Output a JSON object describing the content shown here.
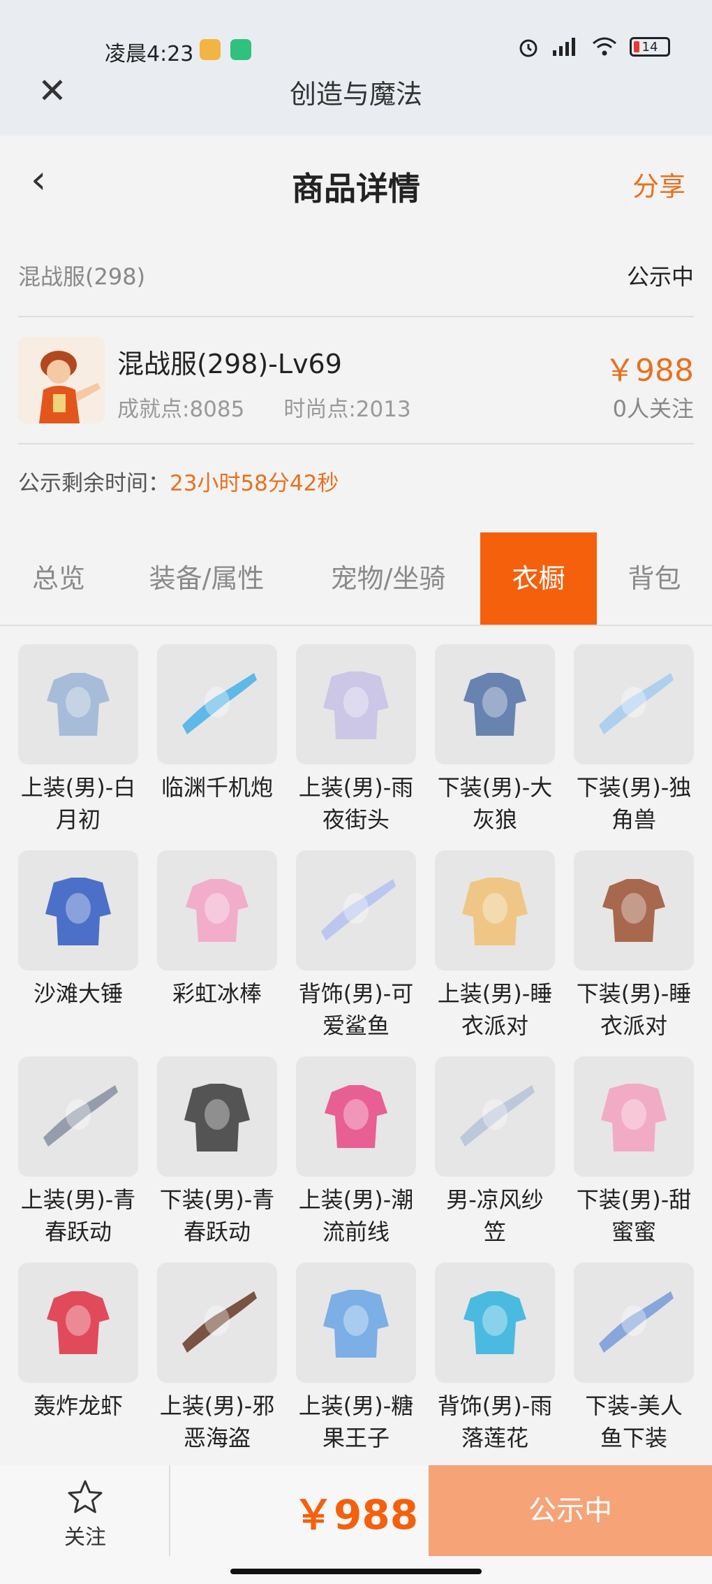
{
  "status": {
    "time": "凌晨4:23",
    "battery": "14"
  },
  "miniprogram": {
    "title": "创造与魔法"
  },
  "header": {
    "title": "商品详情",
    "share": "分享"
  },
  "account": {
    "name": "混战服(298)",
    "status": "公示中",
    "product_name": "混战服(298)-Lv69",
    "achievement": "成就点:8085",
    "fashion": "时尚点:2013",
    "price": "￥988",
    "followers": "0人关注",
    "countdown_label": "公示剩余时间：",
    "countdown_value": "23小时58分42秒"
  },
  "tabs": [
    "总览",
    "装备/属性",
    "宠物/坐骑",
    "衣橱",
    "背包"
  ],
  "active_tab": 3,
  "items": [
    {
      "line1": "上装(男)-白",
      "line2": "月初",
      "icon": "shirt-icon",
      "color": "#9fb7d6"
    },
    {
      "line1": "临渊千机炮",
      "line2": "",
      "icon": "cannon-icon",
      "color": "#4fb3e8"
    },
    {
      "line1": "上装(男)-雨",
      "line2": "夜街头",
      "icon": "jacket-icon",
      "color": "#c9c3e6"
    },
    {
      "line1": "下装(男)-大",
      "line2": "灰狼",
      "icon": "pants-icon",
      "color": "#5a78a8"
    },
    {
      "line1": "下装(男)-独",
      "line2": "角兽",
      "icon": "boots-icon",
      "color": "#a9ccf0"
    },
    {
      "line1": "沙滩大锤",
      "line2": "",
      "icon": "hammer-icon",
      "color": "#3b63c4"
    },
    {
      "line1": "彩虹冰棒",
      "line2": "",
      "icon": "popsicle-icon",
      "color": "#f3a6c8"
    },
    {
      "line1": "背饰(男)-可",
      "line2": "爱鲨鱼",
      "icon": "shark-icon",
      "color": "#b6c3ee"
    },
    {
      "line1": "上装(男)-睡",
      "line2": "衣派对",
      "icon": "pajama-top-icon",
      "color": "#f0c27a"
    },
    {
      "line1": "下装(男)-睡",
      "line2": "衣派对",
      "icon": "slippers-icon",
      "color": "#a05a3c"
    },
    {
      "line1": "上装(男)-青",
      "line2": "春跃动",
      "icon": "vest-icon",
      "color": "#8c93a3"
    },
    {
      "line1": "下装(男)-青",
      "line2": "春跃动",
      "icon": "sneakers-icon",
      "color": "#444444"
    },
    {
      "line1": "上装(男)-潮",
      "line2": "流前线",
      "icon": "hoodie-icon",
      "color": "#e8508a"
    },
    {
      "line1": "男-凉风纱",
      "line2": "笠",
      "icon": "veil-hat-icon",
      "color": "#b8c4d8"
    },
    {
      "line1": "下装(男)-甜",
      "line2": "蜜蜜",
      "icon": "shorts-icon",
      "color": "#f2a4c0"
    },
    {
      "line1": "轰炸龙虾",
      "line2": "",
      "icon": "lobster-icon",
      "color": "#e0394b"
    },
    {
      "line1": "上装(男)-邪",
      "line2": "恶海盗",
      "icon": "pirate-coat-icon",
      "color": "#6e4330"
    },
    {
      "line1": "上装(男)-糖",
      "line2": "果王子",
      "icon": "prince-coat-icon",
      "color": "#6fa8e6"
    },
    {
      "line1": "背饰(男)-雨",
      "line2": "落莲花",
      "icon": "lotus-staff-icon",
      "color": "#3ab5e0"
    },
    {
      "line1": "下装-美人",
      "line2": "鱼下装",
      "icon": "mermaid-skirt-icon",
      "color": "#7d9ed8"
    }
  ],
  "bottom": {
    "follow": "关注",
    "price": "￥988",
    "action": "公示中"
  }
}
